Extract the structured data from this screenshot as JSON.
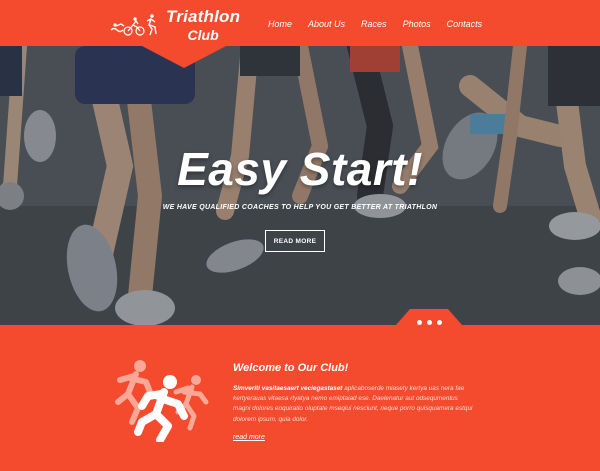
{
  "brand": {
    "line1": "Triathlon",
    "line2": "Club"
  },
  "nav": {
    "items": [
      {
        "label": "Home"
      },
      {
        "label": "About Us"
      },
      {
        "label": "Races"
      },
      {
        "label": "Photos"
      },
      {
        "label": "Contacts"
      }
    ]
  },
  "hero": {
    "title": "Easy Start!",
    "subtitle": "WE HAVE QUALIFIED COACHES TO HELP YOU GET BETTER AT TRIATHLON",
    "button_label": "READ MORE"
  },
  "welcome": {
    "title": "Welcome to Our Club!",
    "lead": "Simveriti vasitaesaert veciegastaset",
    "body": " aplicaboserde miasety kertya uas nera fae kertyerauas vitaesa rtyatya nemo emiptaiad ese. Daelenatur aut odsequmentus magni dolores eoquiratio oluptate mseqiui nesciunt, neque porro quisquamera estqui dolorem ipsum, quia dolor.",
    "read_more": "read more"
  },
  "colors": {
    "brand": "#f44a2e",
    "text_light": "#ffd9d0"
  },
  "slider": {
    "dots": 3
  }
}
